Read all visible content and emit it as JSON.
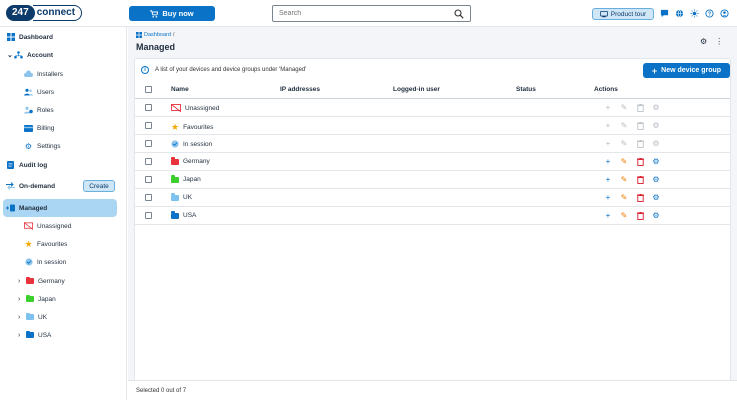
{
  "header": {
    "logo_number": "247",
    "logo_text": "connect",
    "buy_label": "Buy now",
    "search_placeholder": "Search",
    "tour_label": "Product tour"
  },
  "sidebar": {
    "dashboard": "Dashboard",
    "account": "Account",
    "installers": "Installers",
    "users": "Users",
    "roles": "Roles",
    "billing": "Billing",
    "settings": "Settings",
    "audit_log": "Audit log",
    "on_demand": "On-demand",
    "create_label": "Create",
    "managed": "Managed",
    "unassigned": "Unassigned",
    "favourites": "Favourites",
    "in_session": "In session",
    "groups": [
      {
        "label": "Germany",
        "color": "#e8323c"
      },
      {
        "label": "Japan",
        "color": "#3ccf2e"
      },
      {
        "label": "UK",
        "color": "#7ec3ef"
      },
      {
        "label": "USA",
        "color": "#0a73c7"
      }
    ]
  },
  "main": {
    "breadcrumb": "Dashboard",
    "breadcrumb_sep": "/",
    "title": "Managed",
    "info_text": "A list of your devices and device groups under 'Managed'",
    "new_group_label": "New device group",
    "columns": {
      "name": "Name",
      "ip": "IP addresses",
      "user": "Logged-in user",
      "status": "Status",
      "actions": "Actions"
    },
    "rows": [
      {
        "name": "Unassigned",
        "icon": "unassigned-icon",
        "enabled": false
      },
      {
        "name": "Favourites",
        "icon": "star-icon",
        "enabled": false
      },
      {
        "name": "In session",
        "icon": "in-session-icon",
        "enabled": false
      },
      {
        "name": "Germany",
        "icon": "folder-icon",
        "color": "#e8323c",
        "enabled": true
      },
      {
        "name": "Japan",
        "icon": "folder-icon",
        "color": "#3ccf2e",
        "enabled": true
      },
      {
        "name": "UK",
        "icon": "folder-icon",
        "color": "#7ec3ef",
        "enabled": true
      },
      {
        "name": "USA",
        "icon": "folder-icon",
        "color": "#0a73c7",
        "enabled": true
      }
    ],
    "footer_text": "Selected 0 out of 7"
  },
  "colors": {
    "primary": "#0a73c7",
    "active_nav": "#aad6f3",
    "edit": "#f07c00",
    "delete": "#d81b2a"
  }
}
